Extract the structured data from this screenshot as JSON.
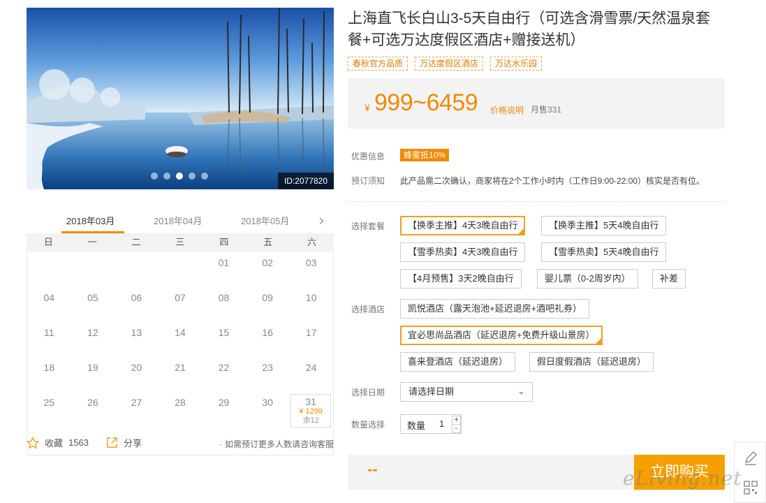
{
  "hero": {
    "id_badge": "ID:2077820",
    "slide_count": 5,
    "active_slide": 3
  },
  "calendar": {
    "months": [
      "2018年03月",
      "2018年04月",
      "2018年05月"
    ],
    "weekdays": [
      "日",
      "一",
      "二",
      "三",
      "四",
      "五",
      "六"
    ],
    "rows": [
      [
        "",
        "",
        "",
        "",
        "01",
        "02",
        "03"
      ],
      [
        "04",
        "05",
        "06",
        "07",
        "08",
        "09",
        "10"
      ],
      [
        "11",
        "12",
        "13",
        "14",
        "15",
        "16",
        "17"
      ],
      [
        "18",
        "19",
        "20",
        "21",
        "22",
        "23",
        "24"
      ],
      [
        "25",
        "26",
        "27",
        "28",
        "29",
        "30",
        "31"
      ]
    ],
    "available": {
      "day": "31",
      "price": "¥ 1299",
      "stock": "余12"
    }
  },
  "meta": {
    "favorite_label": "收藏",
    "favorite_count": "1563",
    "share_label": "分享",
    "note": "· 如需预订更多人数请咨询客服"
  },
  "product": {
    "title": "上海直飞长白山3-5天自由行（可选含滑雪票/天然温泉套餐+可选万达度假区酒店+赠接送机）",
    "tags": [
      "春秋官方品质",
      "万达度假区酒店",
      "万达水乐园"
    ],
    "currency": "¥",
    "price_range": "999~6459",
    "price_explain": "价格说明",
    "monthly_sales": "月售331"
  },
  "info": {
    "promo_label": "优惠信息",
    "promo_badge": "蜂蜜抵10%",
    "notice_label": "预订须知",
    "notice_text": "此产品需二次确认，商家将在2个工作小时内（工作日9:00-22:00）核实是否有位。"
  },
  "packages": {
    "label": "选择套餐",
    "options": [
      "【换季主推】4天3晚自由行",
      "【换季主推】5天4晚自由行",
      "【雪季热卖】4天3晚自由行",
      "【雪季热卖】5天4晚自由行",
      "【4月预售】3天2晚自由行",
      "婴儿票（0-2周岁内）",
      "补差"
    ],
    "selected_index": 0
  },
  "hotels": {
    "label": "选择酒店",
    "options": [
      "凯悦酒店（露天泡池+延迟退房+酒吧礼券）",
      "宜必思尚品酒店（延迟退房+免费升级山景房）",
      "喜来登酒店（延迟退房）",
      "假日度假酒店（延迟退房）"
    ],
    "selected_index": 1
  },
  "date": {
    "label": "选择日期",
    "placeholder": "请选择日期"
  },
  "quantity": {
    "label": "数量选择",
    "field_label": "数量",
    "value": "1",
    "plus": "+",
    "minus": "-"
  },
  "checkout": {
    "total": "--",
    "buy_label": "立即购买"
  },
  "watermark": "eLiving.net",
  "colors": {
    "accent": "#f08a00",
    "button": "#f5a000",
    "selected_border": "#f0a020"
  }
}
